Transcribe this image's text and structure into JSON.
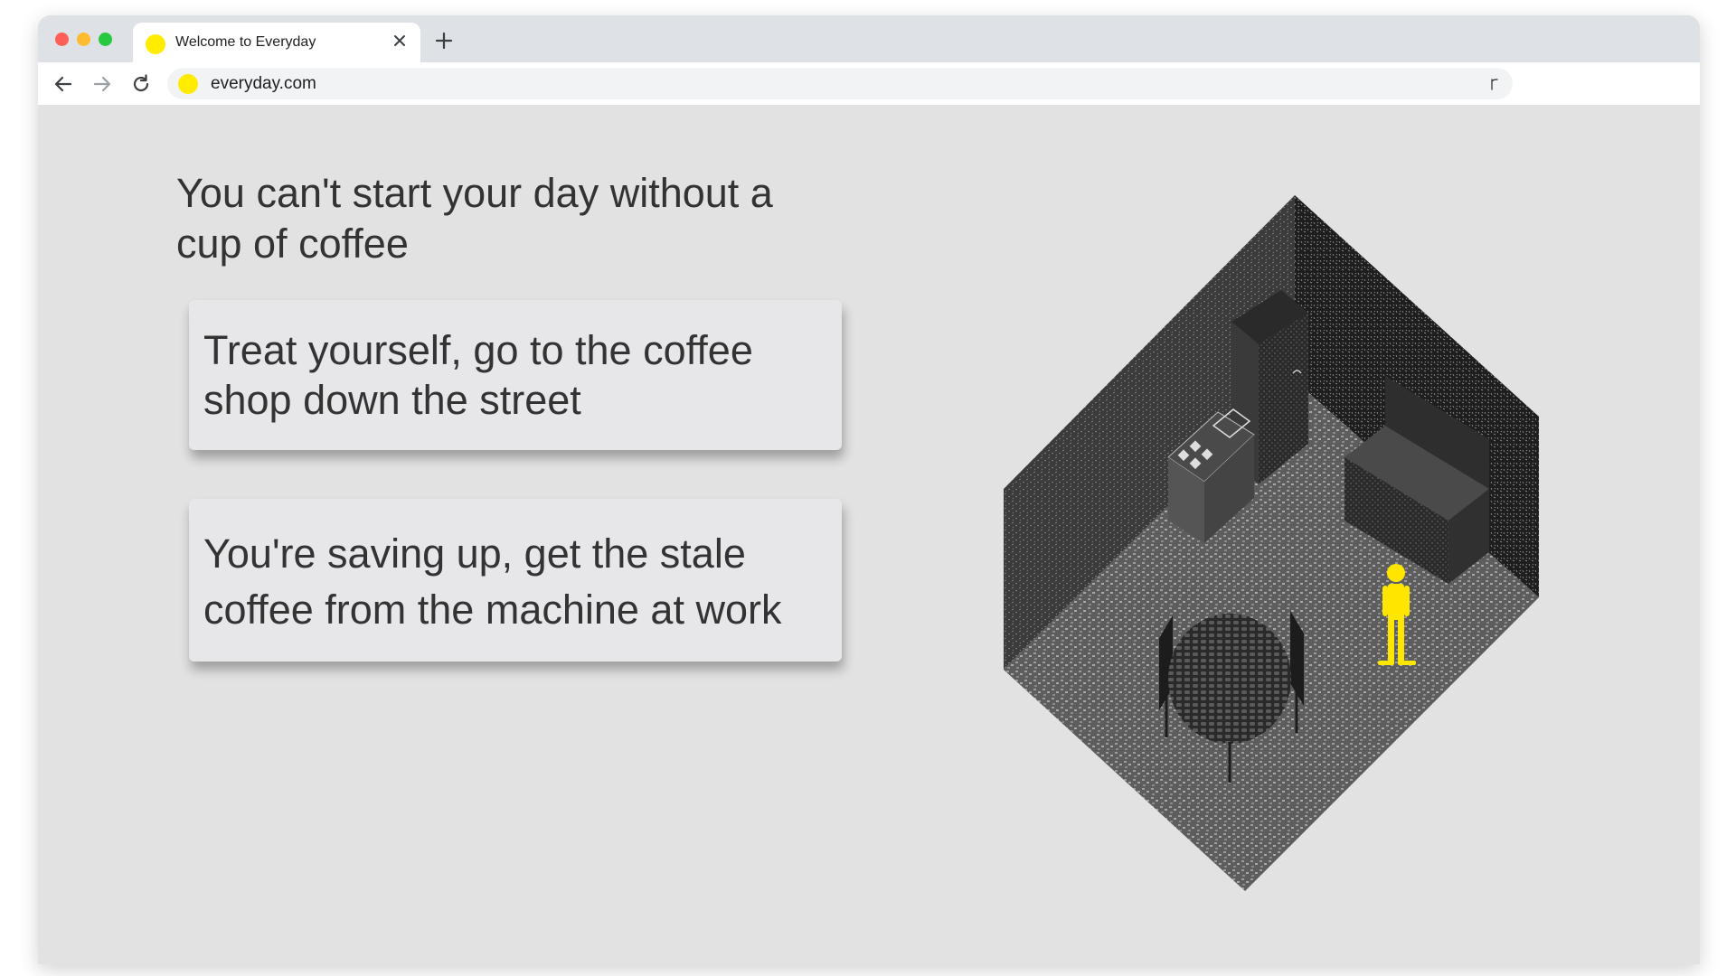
{
  "browser": {
    "tab_title": "Welcome to Everyday",
    "url": "everyday.com",
    "favicon_color": "#ffec00"
  },
  "page": {
    "headline": "You can't start your day without a cup of coffee",
    "choices": [
      {
        "label": "Treat yourself, go to the coffee shop down the street"
      },
      {
        "label": "You're saving up, get the stale coffee from the machine at work"
      }
    ],
    "player_color": "#ffe600"
  }
}
